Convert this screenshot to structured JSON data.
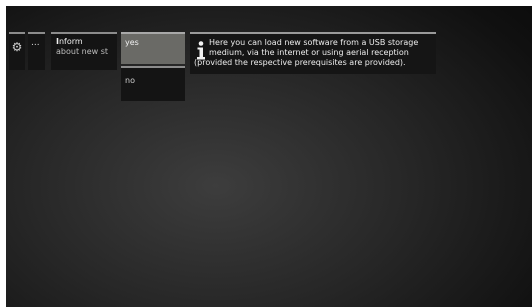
{
  "menu": {
    "gear_icon": "gear-icon",
    "more_label": "...",
    "setting": {
      "title": "Inform",
      "subtitle": "about new st"
    },
    "options": [
      {
        "label": "yes",
        "selected": true
      },
      {
        "label": "no",
        "selected": false
      }
    ]
  },
  "info_panel": {
    "icon": "info-icon",
    "line1": "Here you can load new software from a USB storage",
    "line2": "medium, via the internet or using aerial reception",
    "line3": "(provided the respective prerequisites are provided)."
  },
  "colors": {
    "background_center": "#3d3d3d",
    "background_edge": "#050505",
    "selected_option": "#6a6a66",
    "tile": "#141414",
    "text": "#ededed"
  }
}
